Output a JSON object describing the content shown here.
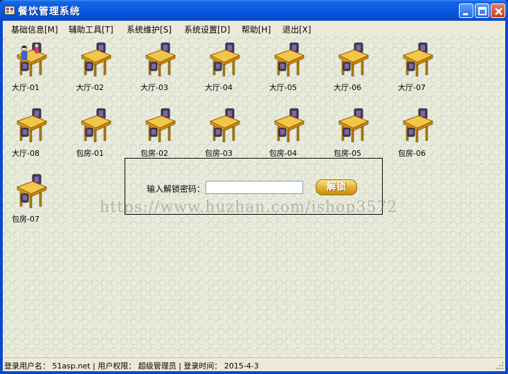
{
  "window": {
    "title": "餐饮管理系统",
    "icon": "app-icon"
  },
  "menu": {
    "items": [
      {
        "label": "基础信息[M]"
      },
      {
        "label": "辅助工具[T]"
      },
      {
        "label": "系统维护[S]"
      },
      {
        "label": "系统设置[D]"
      },
      {
        "label": "帮助[H]"
      },
      {
        "label": "退出[X]"
      }
    ]
  },
  "tables": [
    {
      "label": "大厅-01",
      "occupied": true
    },
    {
      "label": "大厅-02",
      "occupied": false
    },
    {
      "label": "大厅-03",
      "occupied": false
    },
    {
      "label": "大厅-04",
      "occupied": false
    },
    {
      "label": "大厅-05",
      "occupied": false
    },
    {
      "label": "大厅-06",
      "occupied": false
    },
    {
      "label": "大厅-07",
      "occupied": false
    },
    {
      "label": "大厅-08",
      "occupied": false
    },
    {
      "label": "包房-01",
      "occupied": false
    },
    {
      "label": "包房-02",
      "occupied": false
    },
    {
      "label": "包房-03",
      "occupied": false
    },
    {
      "label": "包房-04",
      "occupied": false
    },
    {
      "label": "包房-05",
      "occupied": false
    },
    {
      "label": "包房-06",
      "occupied": false
    },
    {
      "label": "包房-07",
      "occupied": false
    }
  ],
  "unlock": {
    "label": "输入解锁密码：",
    "value": "",
    "button_label": "解锁"
  },
  "watermark": "https://www.huzhan.com/ishop3572",
  "status": {
    "text": "登录用户名： 51asp.net | 用户权限： 超级管理员 | 登录时间： 2015-4-3"
  },
  "colors": {
    "title_bar": "#0a5be0",
    "client_bg": "#eef1e6",
    "menu_bg": "#ece9d8",
    "table_top": "#f3c64a",
    "chair": "#4a3a6a"
  }
}
